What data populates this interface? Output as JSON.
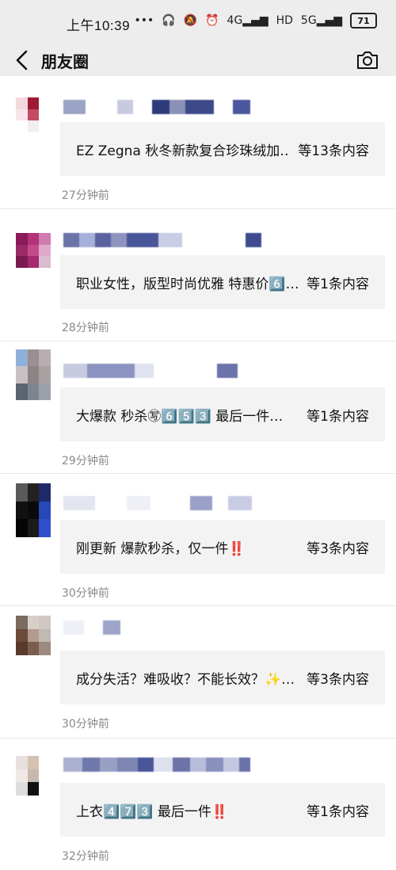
{
  "status": {
    "time": "上午10:39",
    "icons": [
      "dots-icon",
      "headphones-icon",
      "mute-icon",
      "alarm-icon",
      "4g-signal-icon",
      "hd-icon",
      "5g-signal-icon"
    ],
    "signal_4g": "4G",
    "hd": "HD",
    "signal_5g": "5G",
    "battery": "71"
  },
  "nav": {
    "title": "朋友圈"
  },
  "posts": [
    {
      "snippet": "EZ Zegna 秋冬新款复合珍珠绒加…",
      "count": "等13条内容",
      "time": "27分钟前"
    },
    {
      "snippet": "职业女性，版型时尚优雅 特惠价6️⃣…",
      "count": "等1条内容",
      "time": "28分钟前"
    },
    {
      "snippet": "大爆款 秒杀㊢6️⃣5️⃣3️⃣ 最后一件…",
      "count": "等1条内容",
      "time": "29分钟前"
    },
    {
      "snippet": "刚更新 爆款秒杀，仅一件‼️",
      "count": "等3条内容",
      "time": "30分钟前"
    },
    {
      "snippet": "成分失活？难吸收？不能长效？✨…",
      "count": "等3条内容",
      "time": "30分钟前"
    },
    {
      "snippet": "上衣4️⃣7️⃣3️⃣ 最后一件‼️",
      "count": "等1条内容",
      "time": "32分钟前"
    }
  ]
}
